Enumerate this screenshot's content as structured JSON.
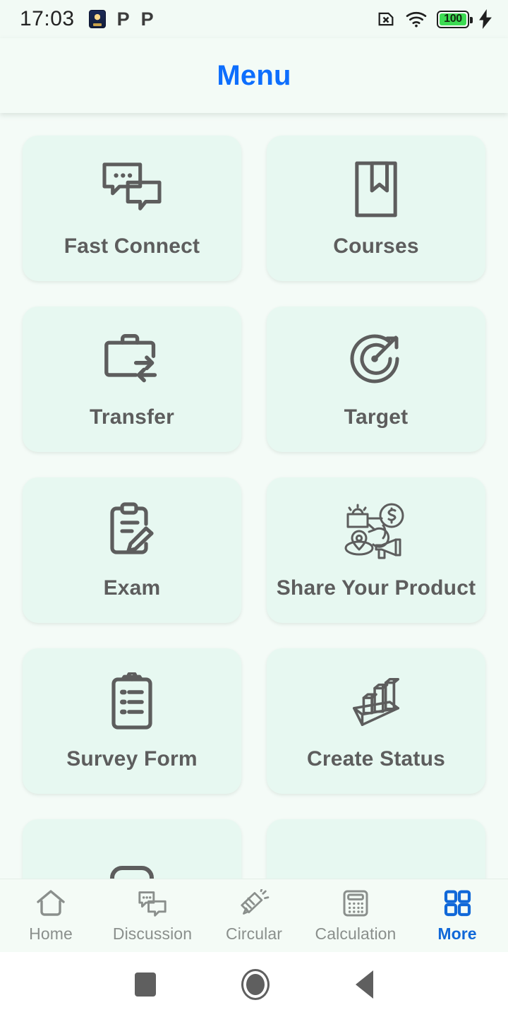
{
  "statusbar": {
    "time": "17:03",
    "notif_icons": [
      "app-badge-icon",
      "p-notification-icon",
      "p-notification-icon"
    ],
    "p_glyph": "P",
    "right_icons": [
      "no-sim-icon",
      "wifi-icon",
      "battery-icon",
      "charging-bolt-icon"
    ],
    "battery_level": "100"
  },
  "header": {
    "title": "Menu",
    "title_color": "#0d6efd"
  },
  "theme": {
    "page_bg": "#f4fbf7",
    "card_bg": "#e7f8f1",
    "icon_color": "#5d5d5d",
    "accent": "#1168d8",
    "nav_inactive": "#8a8f8c"
  },
  "menu": {
    "items": [
      {
        "label": "Fast Connect",
        "icon": "chat-bubbles-icon"
      },
      {
        "label": "Courses",
        "icon": "book-bookmark-icon"
      },
      {
        "label": "Transfer",
        "icon": "briefcase-exchange-icon"
      },
      {
        "label": "Target",
        "icon": "target-arrow-icon"
      },
      {
        "label": "Exam",
        "icon": "clipboard-pencil-icon"
      },
      {
        "label": "Share Your Product",
        "icon": "share-product-icon"
      },
      {
        "label": "Survey Form",
        "icon": "clipboard-list-icon"
      },
      {
        "label": "Create Status",
        "icon": "bar-chart-3d-icon"
      },
      {
        "label": "",
        "icon": "rounded-shape-icon"
      },
      {
        "label": "",
        "icon": ""
      }
    ]
  },
  "bottom_nav": {
    "items": [
      {
        "label": "Home",
        "icon": "home-icon",
        "active": false
      },
      {
        "label": "Discussion",
        "icon": "chat-icon",
        "active": false
      },
      {
        "label": "Circular",
        "icon": "megaphone-icon",
        "active": false
      },
      {
        "label": "Calculation",
        "icon": "calculator-icon",
        "active": false
      },
      {
        "label": "More",
        "icon": "grid-squares-icon",
        "active": true
      }
    ]
  },
  "android_nav": {
    "items": [
      "recents-square-button",
      "home-circle-button",
      "back-triangle-button"
    ]
  }
}
